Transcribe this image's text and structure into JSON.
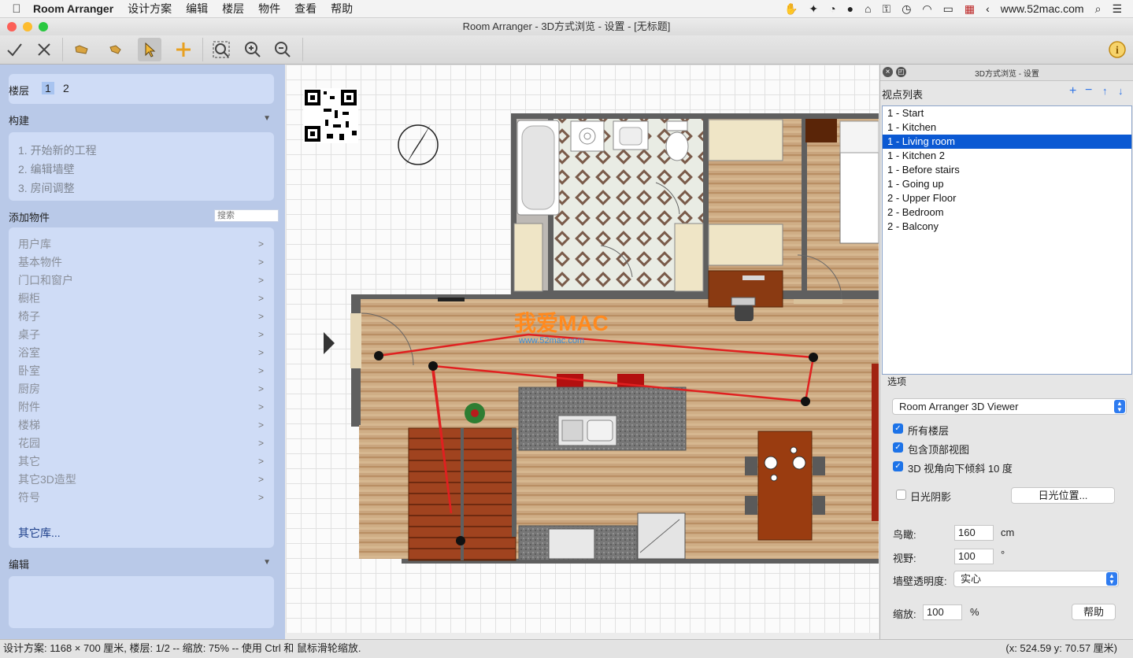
{
  "menubar": {
    "app_name": "Room Arranger",
    "menus": [
      "设计方案",
      "编辑",
      "楼层",
      "物件",
      "查看",
      "帮助"
    ],
    "url": "www.52mac.com"
  },
  "window": {
    "title": "Room Arranger - 3D方式浏览 - 设置 - [无标题]"
  },
  "toolbar": {
    "buttons": [
      "check-icon",
      "cancel-icon",
      "open-folder-icon",
      "hand-icon",
      "select-arrow-icon",
      "add-plus-icon",
      "zoom-fit-icon",
      "zoom-in-icon",
      "zoom-out-icon",
      "info-icon"
    ]
  },
  "sidebar": {
    "floors_label": "楼层",
    "floors": [
      "1",
      "2"
    ],
    "build_label": "构建",
    "build_steps": [
      "1. 开始新的工程",
      "2. 编辑墙壁",
      "3. 房间调整"
    ],
    "add_label": "添加物件",
    "search_placeholder": "搜索",
    "library": [
      "用户库",
      "基本物件",
      "门口和窗户",
      "橱柜",
      "椅子",
      "桌子",
      "浴室",
      "卧室",
      "厨房",
      "附件",
      "楼梯",
      "花园",
      "其它",
      "其它3D造型",
      "符号"
    ],
    "other_lib": "其它库...",
    "edit_label": "编辑"
  },
  "canvas": {
    "watermark_logo": "我爱MAC",
    "watermark_url": "www.52mac.com"
  },
  "panel": {
    "title": "3D方式浏览 - 设置",
    "viewpoints_label": "视点列表",
    "viewpoints": [
      "1 - Start",
      "1 - Kitchen",
      "1 - Living room",
      "1 - Kitchen 2",
      "1 - Before stairs",
      "1 - Going up",
      "2 - Upper Floor",
      "2 - Bedroom",
      "2 - Balcony"
    ],
    "selected_viewpoint": "1 - Living room",
    "options_label": "选项",
    "viewer": "Room Arranger 3D Viewer",
    "opt_all_floors": "所有楼层",
    "opt_top_view": "包含顶部视图",
    "opt_tilt": "3D 视角向下倾斜 10 度",
    "opt_shadow": "日光阴影",
    "sun_button": "日光位置...",
    "birdseye_label": "鸟瞰:",
    "birdseye_value": "160",
    "birdseye_unit": "cm",
    "fov_label": "视野:",
    "fov_value": "100",
    "fov_unit": "°",
    "transparency_label": "墙壁透明度:",
    "transparency_value": "实心",
    "zoom_label": "缩放:",
    "zoom_value": "100",
    "zoom_unit": "%",
    "help_button": "帮助"
  },
  "status": {
    "left": "设计方案: 1168 × 700 厘米, 楼层: 1/2 -- 缩放: 75% -- 使用 Ctrl 和 鼠标滑轮缩放.",
    "right": "(x: 524.59 y: 70.57 厘米)"
  }
}
